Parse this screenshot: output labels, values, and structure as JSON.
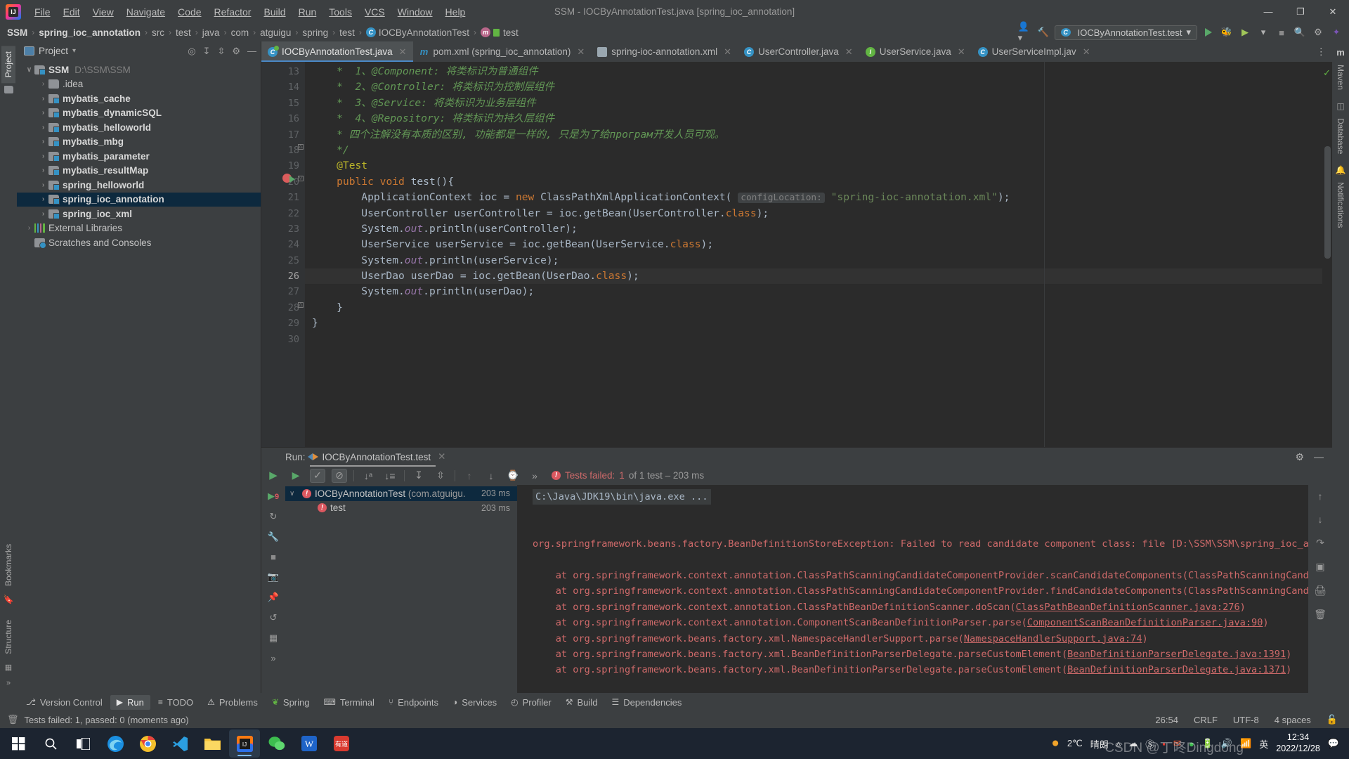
{
  "window": {
    "title": "SSM - IOCByAnnotationTest.java [spring_ioc_annotation]",
    "minimize": "—",
    "maximize": "❐",
    "close": "✕"
  },
  "menu": {
    "items": [
      "File",
      "Edit",
      "View",
      "Navigate",
      "Code",
      "Refactor",
      "Build",
      "Run",
      "Tools",
      "VCS",
      "Window",
      "Help"
    ]
  },
  "breadcrumb": {
    "items": [
      {
        "label": "SSM",
        "bold": true,
        "icon": ""
      },
      {
        "label": "spring_ioc_annotation",
        "bold": true,
        "icon": ""
      },
      {
        "label": "src",
        "bold": false,
        "icon": ""
      },
      {
        "label": "test",
        "bold": false,
        "icon": ""
      },
      {
        "label": "java",
        "bold": false,
        "icon": ""
      },
      {
        "label": "com",
        "bold": false,
        "icon": ""
      },
      {
        "label": "atguigu",
        "bold": false,
        "icon": ""
      },
      {
        "label": "spring",
        "bold": false,
        "icon": ""
      },
      {
        "label": "test",
        "bold": false,
        "icon": ""
      },
      {
        "label": "IOCByAnnotationTest",
        "bold": false,
        "icon": "class-icon"
      },
      {
        "label": "test",
        "bold": false,
        "icon": "method-icon"
      }
    ],
    "run_config": "IOCByAnnotationTest.test"
  },
  "project": {
    "title": "Project",
    "tool_tabs_left": [
      "Project",
      "Bookmarks",
      "Structure"
    ],
    "tool_tabs_right": [
      "Maven",
      "Database",
      "Notifications"
    ],
    "tree": [
      {
        "label": "SSM",
        "path": "D:\\SSM\\SSM",
        "indent": 0,
        "arrow": "∨",
        "icon": "module-folder-icon",
        "bold": true,
        "selected": false
      },
      {
        "label": ".idea",
        "path": "",
        "indent": 1,
        "arrow": "›",
        "icon": "folder-icon",
        "bold": false,
        "selected": false
      },
      {
        "label": "mybatis_cache",
        "path": "",
        "indent": 1,
        "arrow": "›",
        "icon": "module-folder-icon",
        "bold": true,
        "selected": false
      },
      {
        "label": "mybatis_dynamicSQL",
        "path": "",
        "indent": 1,
        "arrow": "›",
        "icon": "module-folder-icon",
        "bold": true,
        "selected": false
      },
      {
        "label": "mybatis_helloworld",
        "path": "",
        "indent": 1,
        "arrow": "›",
        "icon": "module-folder-icon",
        "bold": true,
        "selected": false
      },
      {
        "label": "mybatis_mbg",
        "path": "",
        "indent": 1,
        "arrow": "›",
        "icon": "module-folder-icon",
        "bold": true,
        "selected": false
      },
      {
        "label": "mybatis_parameter",
        "path": "",
        "indent": 1,
        "arrow": "›",
        "icon": "module-folder-icon",
        "bold": true,
        "selected": false
      },
      {
        "label": "mybatis_resultMap",
        "path": "",
        "indent": 1,
        "arrow": "›",
        "icon": "module-folder-icon",
        "bold": true,
        "selected": false
      },
      {
        "label": "spring_helloworld",
        "path": "",
        "indent": 1,
        "arrow": "›",
        "icon": "module-folder-icon",
        "bold": true,
        "selected": false
      },
      {
        "label": "spring_ioc_annotation",
        "path": "",
        "indent": 1,
        "arrow": "›",
        "icon": "module-folder-icon",
        "bold": true,
        "selected": true
      },
      {
        "label": "spring_ioc_xml",
        "path": "",
        "indent": 1,
        "arrow": "›",
        "icon": "module-folder-icon",
        "bold": true,
        "selected": false
      },
      {
        "label": "External Libraries",
        "path": "",
        "indent": 0,
        "arrow": "›",
        "icon": "libraries-icon",
        "bold": false,
        "selected": false
      },
      {
        "label": "Scratches and Consoles",
        "path": "",
        "indent": 0,
        "arrow": "",
        "icon": "scratches-icon",
        "bold": false,
        "selected": false
      }
    ]
  },
  "editor": {
    "tabs": [
      {
        "label": "IOCByAnnotationTest.java",
        "icon": "test-class-icon",
        "active": true
      },
      {
        "label": "pom.xml (spring_ioc_annotation)",
        "icon": "maven-icon",
        "active": false
      },
      {
        "label": "spring-ioc-annotation.xml",
        "icon": "xml-icon",
        "active": false
      },
      {
        "label": "UserController.java",
        "icon": "class-icon",
        "active": false
      },
      {
        "label": "UserService.java",
        "icon": "interface-icon",
        "active": false
      },
      {
        "label": "UserServiceImpl.jav",
        "icon": "class-icon",
        "active": false
      }
    ],
    "first_line": 13,
    "lines": [
      {
        "n": 13,
        "segs": [
          {
            "t": "    *  1、@Component: 将类标识为普通组件",
            "c": "cmt"
          }
        ]
      },
      {
        "n": 14,
        "segs": [
          {
            "t": "    *  2、@Controller: 将类标识为控制层组件",
            "c": "cmt"
          }
        ]
      },
      {
        "n": 15,
        "segs": [
          {
            "t": "    *  3、@Service: 将类标识为业务层组件",
            "c": "cmt"
          }
        ]
      },
      {
        "n": 16,
        "segs": [
          {
            "t": "    *  4、@Repository: 将类标识为持久层组件",
            "c": "cmt"
          }
        ]
      },
      {
        "n": 17,
        "segs": [
          {
            "t": "    * 四个注解没有本质的区别, 功能都是一样的, 只是为了给програм开发人员可观。",
            "c": "cmt"
          }
        ]
      },
      {
        "n": 18,
        "segs": [
          {
            "t": "    */",
            "c": "cmt"
          }
        ]
      },
      {
        "n": 19,
        "segs": [
          {
            "t": "    @Test",
            "c": "ann"
          }
        ]
      },
      {
        "n": 20,
        "segs": [
          {
            "t": "    ",
            "c": ""
          },
          {
            "t": "public",
            "c": "kw"
          },
          {
            "t": " ",
            "c": ""
          },
          {
            "t": "void",
            "c": "kw"
          },
          {
            "t": " test(){",
            "c": ""
          }
        ]
      },
      {
        "n": 21,
        "segs": [
          {
            "t": "        ApplicationContext ioc = ",
            "c": ""
          },
          {
            "t": "new",
            "c": "kw"
          },
          {
            "t": " ClassPathXmlApplicationContext( ",
            "c": ""
          },
          {
            "t": "configLocation:",
            "c": "hint"
          },
          {
            "t": " ",
            "c": ""
          },
          {
            "t": "\"spring-ioc-annotation.xml\"",
            "c": "str"
          },
          {
            "t": ");",
            "c": ""
          }
        ]
      },
      {
        "n": 22,
        "segs": [
          {
            "t": "        UserController userController = ioc.getBean(UserController.",
            "c": ""
          },
          {
            "t": "class",
            "c": "kw"
          },
          {
            "t": ");",
            "c": ""
          }
        ]
      },
      {
        "n": 23,
        "segs": [
          {
            "t": "        System.",
            "c": ""
          },
          {
            "t": "out",
            "c": "fld"
          },
          {
            "t": ".println(userController);",
            "c": ""
          }
        ]
      },
      {
        "n": 24,
        "segs": [
          {
            "t": "        UserService userService = ioc.getBean(UserService.",
            "c": ""
          },
          {
            "t": "class",
            "c": "kw"
          },
          {
            "t": ");",
            "c": ""
          }
        ]
      },
      {
        "n": 25,
        "segs": [
          {
            "t": "        System.",
            "c": ""
          },
          {
            "t": "out",
            "c": "fld"
          },
          {
            "t": ".println(userService);",
            "c": ""
          }
        ]
      },
      {
        "n": 26,
        "segs": [
          {
            "t": "        UserDao userDao = ioc.getBean(UserDao.",
            "c": ""
          },
          {
            "t": "class",
            "c": "kw"
          },
          {
            "t": ");",
            "c": ""
          }
        ],
        "highlight": true
      },
      {
        "n": 27,
        "segs": [
          {
            "t": "        System.",
            "c": ""
          },
          {
            "t": "out",
            "c": "fld"
          },
          {
            "t": ".println(userDao);",
            "c": ""
          }
        ]
      },
      {
        "n": 28,
        "segs": [
          {
            "t": "    }",
            "c": ""
          }
        ]
      },
      {
        "n": 29,
        "segs": [
          {
            "t": "}",
            "c": ""
          }
        ]
      },
      {
        "n": 30,
        "segs": [
          {
            "t": "",
            "c": ""
          }
        ]
      }
    ]
  },
  "run_panel": {
    "label": "Run:",
    "tab_name": "IOCByAnnotationTest.test",
    "status_prefix": "Tests failed:",
    "status_count": "1",
    "status_suffix": "of 1 test – 203 ms",
    "tree": [
      {
        "label": "IOCByAnnotationTest",
        "suffix": "(com.atguigu.",
        "duration": "203 ms",
        "indent": 0,
        "selected": true,
        "arrow": "∨"
      },
      {
        "label": "test",
        "suffix": "",
        "duration": "203 ms",
        "indent": 1,
        "selected": false,
        "arrow": ""
      }
    ],
    "console": [
      {
        "text": "C:\\Java\\JDK19\\bin\\java.exe ...",
        "style": "cmd"
      },
      {
        "text": "",
        "style": "blank"
      },
      {
        "text": "",
        "style": "blank"
      },
      {
        "text": "org.springframework.beans.factory.BeanDefinitionStoreException: Failed to read candidate component class: file [D:\\SSM\\SSM\\spring_ioc_annotat",
        "style": "err"
      },
      {
        "text": "",
        "style": "blank"
      },
      {
        "text": "    at org.springframework.context.annotation.ClassPathScanningCandidateComponentProvider.scanCandidateComponents(ClassPathScanningCandidateC",
        "style": "err"
      },
      {
        "text": "    at org.springframework.context.annotation.ClassPathScanningCandidateComponentProvider.findCandidateComponents(ClassPathScanningCandidateC",
        "style": "err"
      },
      {
        "text": "    at org.springframework.context.annotation.ClassPathBeanDefinitionScanner.doScan(ClassPathBeanDefinitionScanner.java:276)",
        "style": "err"
      },
      {
        "text": "    at org.springframework.context.annotation.ComponentScanBeanDefinitionParser.parse(ComponentScanBeanDefinitionParser.java:90)",
        "style": "err"
      },
      {
        "text": "    at org.springframework.beans.factory.xml.NamespaceHandlerSupport.parse(NamespaceHandlerSupport.java:74)",
        "style": "err"
      },
      {
        "text": "    at org.springframework.beans.factory.xml.BeanDefinitionParserDelegate.parseCustomElement(BeanDefinitionParserDelegate.java:1391)",
        "style": "err"
      },
      {
        "text": "    at org.springframework.beans.factory.xml.BeanDefinitionParserDelegate.parseCustomElement(BeanDefinitionParserDelegate.java:1371)",
        "style": "err"
      }
    ]
  },
  "tool_window_bar": {
    "items": [
      {
        "label": "Version Control",
        "icon": "branch-icon",
        "active": false
      },
      {
        "label": "Run",
        "icon": "run-icon",
        "active": true
      },
      {
        "label": "TODO",
        "icon": "todo-icon",
        "active": false
      },
      {
        "label": "Problems",
        "icon": "problems-icon",
        "active": false
      },
      {
        "label": "Spring",
        "icon": "spring-leaf-icon",
        "active": false
      },
      {
        "label": "Terminal",
        "icon": "terminal-icon",
        "active": false
      },
      {
        "label": "Endpoints",
        "icon": "endpoints-icon",
        "active": false
      },
      {
        "label": "Services",
        "icon": "services-icon",
        "active": false
      },
      {
        "label": "Profiler",
        "icon": "profiler-icon",
        "active": false
      },
      {
        "label": "Build",
        "icon": "build-icon",
        "active": false
      },
      {
        "label": "Dependencies",
        "icon": "dependencies-icon",
        "active": false
      }
    ]
  },
  "status_bar": {
    "message": "Tests failed: 1, passed: 0 (moments ago)",
    "caret": "26:54",
    "line_sep": "CRLF",
    "encoding": "UTF-8",
    "indent": "4 spaces"
  },
  "taskbar": {
    "weather_temp": "2℃",
    "weather_desc": "晴朗",
    "ime": "英",
    "time": "12:34",
    "date": "2022/12/28",
    "watermark": "CSDN @丁咚Dingdong"
  },
  "colors": {
    "accent": "#4a88c7",
    "error": "#cf6a6a",
    "success": "#62b543",
    "selection": "#0d293e",
    "editor_bg": "#2b2b2b",
    "panel_bg": "#3c3f41"
  }
}
